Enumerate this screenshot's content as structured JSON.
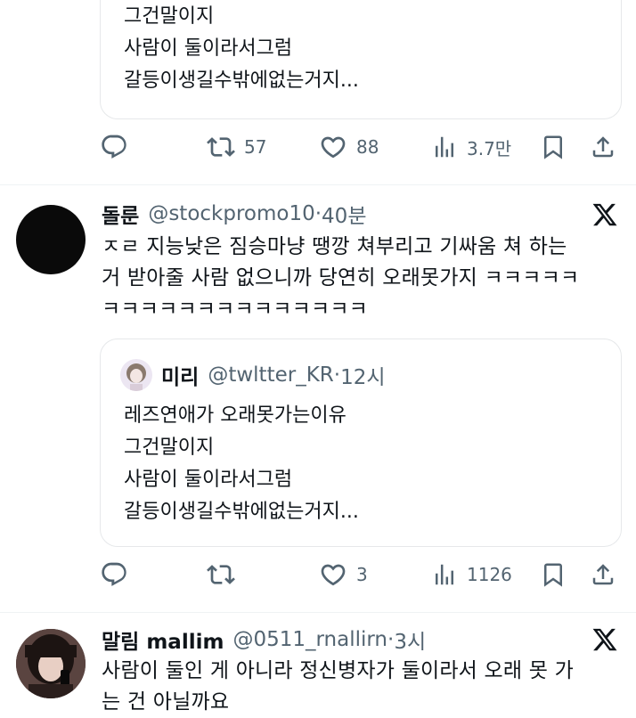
{
  "tweet1": {
    "quote_lines": [
      "그건말이지",
      "사람이 둘이라서그럼",
      "갈등이생길수밖에없는거지..."
    ],
    "actions": {
      "reply": "",
      "retweet": "57",
      "like": "88",
      "views": "3.7만"
    }
  },
  "tweet2": {
    "name": "돌룬",
    "handle": "@stockpromo10",
    "time": "40분",
    "body_lines": [
      "ㅈㄹ 지능낮은 짐승마냥 땡깡 쳐부리고 기싸움 쳐 하는",
      "거 받아줄 사람 없으니까 당연히 오래못가지 ㅋㅋㅋㅋㅋ",
      "ㅋㅋㅋㅋㅋㅋㅋㅋㅋㅋㅋㅋㅋㅋ"
    ],
    "quote": {
      "name": "미리",
      "handle": "@twltter_KR",
      "time": "12시",
      "lines": [
        "레즈연애가 오래못가는이유",
        "그건말이지",
        "사람이 둘이라서그럼",
        "갈등이생길수밖에없는거지..."
      ]
    },
    "actions": {
      "reply": "",
      "retweet": "",
      "like": "3",
      "views": "1126"
    }
  },
  "tweet3": {
    "name": "말림 mallim",
    "handle": "@0511_rnallirn",
    "time": "3시",
    "body_lines": [
      "사람이 둘인 게 아니라 정신병자가 둘이라서 오래 못 가",
      "는 건 아닐까요"
    ]
  },
  "colors": {
    "text": "#0f1419",
    "secondary": "#536471",
    "border": "#e6e8ea"
  }
}
